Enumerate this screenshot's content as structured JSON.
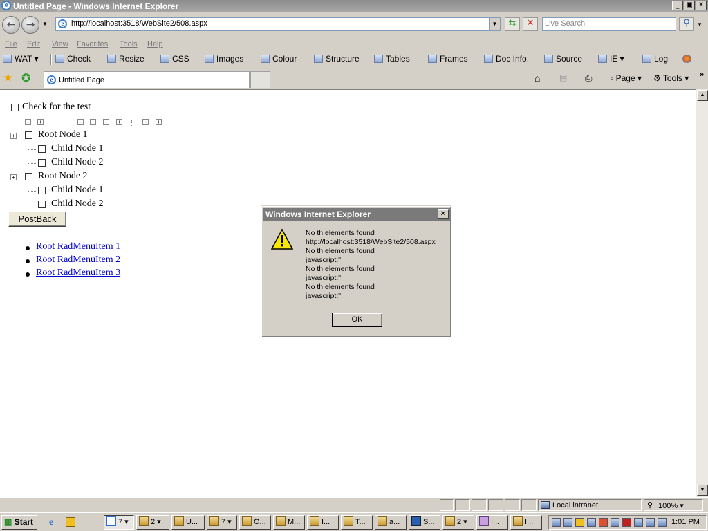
{
  "window": {
    "title": "Untitled Page - Windows Internet Explorer"
  },
  "address": {
    "url": "http://localhost:3518/WebSite2/508.aspx",
    "search_placeholder": "Live Search"
  },
  "menu": [
    "File",
    "Edit",
    "View",
    "Favorites",
    "Tools",
    "Help"
  ],
  "wat_toolbar": [
    "WAT",
    "Check",
    "Resize",
    "CSS",
    "Images",
    "Colour",
    "Structure",
    "Tables",
    "Frames",
    "Doc Info.",
    "Source",
    "IE",
    "Log"
  ],
  "tab": {
    "title": "Untitled Page"
  },
  "command_bar": {
    "page": "Page",
    "tools": "Tools"
  },
  "page": {
    "check_label": "Check for the test",
    "tree": [
      {
        "label": "Root Node 1",
        "children": [
          "Child Node 1",
          "Child Node 2"
        ]
      },
      {
        "label": "Root Node 2",
        "children": [
          "Child Node 1",
          "Child Node 2"
        ]
      }
    ],
    "postback_label": "PostBack",
    "menu_items": [
      "Root RadMenuItem 1",
      "Root RadMenuItem 2",
      "Root RadMenuItem 3"
    ]
  },
  "dialog": {
    "title": "Windows Internet Explorer",
    "lines": [
      "No th elements found",
      "http://localhost:3518/WebSite2/508.aspx",
      "No th elements found",
      "javascript:\";",
      "No th elements found",
      "javascript:\";",
      "No th elements found",
      "javascript:\";"
    ],
    "ok_label": "OK"
  },
  "status": {
    "zone": "Local intranet",
    "zoom": "100%"
  },
  "taskbar": {
    "start_label": "Start",
    "buttons": [
      "7",
      "2",
      "U...",
      "7",
      "O...",
      "M...",
      "I...",
      "T...",
      "a...",
      "S...",
      "2",
      "I...",
      "I..."
    ],
    "clock": "1:01 PM"
  }
}
